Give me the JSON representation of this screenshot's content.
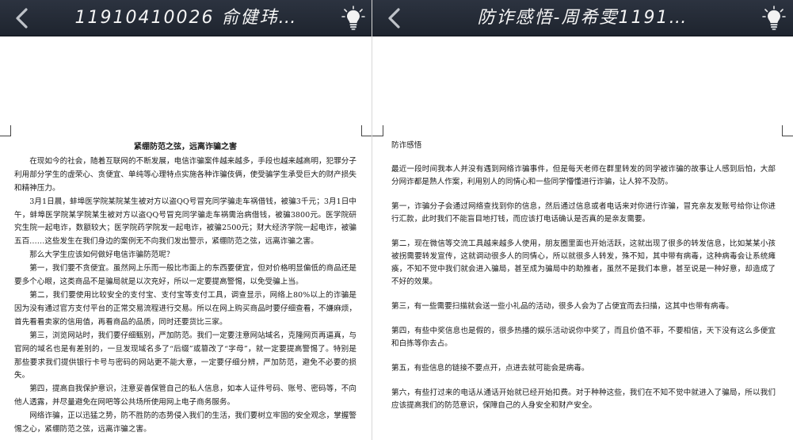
{
  "left": {
    "title": "11910410026 俞健玮…",
    "doc_title": "紧绷防范之弦，远离诈骗之害",
    "paragraphs": [
      "在现如今的社会，随着互联网的不断发展，电信诈骗案件越来越多，手段也越来越高明，犯罪分子利用部分学生的虚荣心、贪便宜、单纯等心理特点实施各种诈骗伎俩，使受骗学生承受巨大的财产损失和精神压力。",
      "3月1日晨，蚌埠医学院某院某生被对方以盗QQ号冒充同学骗走车祸借钱，被骗3千元；3月1日中午，蚌埠医学院某学院某生被对方以盗QQ号冒充同学骗走车祸需治病借钱，被骗3800元。医学院研究生院一起电诈，数额较大；医学院药学院发一起电诈，被骗2500元；财大经济学院一起电诈，被骗五百……这些发生在我们身边的案例无不向我们发出警示，紧绷防范之弦，远离诈骗之害。",
      "那么大学生应该如何做好电信诈骗防范呢？",
      "第一，我们要不贪便宜。虽然网上乐而一般比市面上的东西要便宜，但对价格明显偏低的商品还是要多个心眼，这类商品不是骗局就是以次充好，所以一定要提高警惕，以免受骗上当。",
      "第二，我们要使用比较安全的支付宝、支付宝等支付工具，调查显示，网络上80%以上的诈骗是因为没有通过官方支付平台的正常交易流程进行交易。所以在网上购买商品时要仔细查看，不嫌麻烦，首先看看卖家的信用值，再看商品的品质，同时还要货比三家。",
      "第三，浏览网站时，我们要仔细甄别，严加防范。我们一定要注意网站域名，克隆网页再逼真，与官网的域名也是有差别的，一旦发现域名多了“后缀”或篡改了“字母”，就一定要提高警惕了。特别是那些要求我们提供银行卡号与密码的网站更不能大意，一定要仔细分辨，严加防范，避免不必要的损失。",
      "第四，提高自我保护意识，注意妥善保管自己的私人信息，如本人证件号码、账号、密码等，不向他人透露，并尽量避免在网吧等公共场所使用网上电子商务服务。",
      "网络诈骗，正以迅猛之势，防不胜防的态势侵入我们的生活，我们要树立牢固的安全观念，掌握警惕之心，紧绷防范之弦，远离诈骗之害。"
    ]
  },
  "right": {
    "title": "防诈感悟-周希雯1191…",
    "heading": "防诈感悟",
    "paragraphs": [
      "最近一段时间我本人并没有遇到网络诈骗事件，但是每天老师在群里转发的同学被诈骗的故事让人感到后怕，大部分网诈都是熟人作案，利用别人的同情心和一些同学懵懂进行诈骗，让人猝不及防。",
      "第一，诈骗分子会通过网络查找到你的信息，然后通过信息或者电话来对你进行诈骗，冒充亲友发账号给你让你进行汇款，此时我们不能盲目地打钱，而应该打电话确认是否真的是亲友需要。",
      "第二，现在微信等交流工具越来越多人使用，朋友圈里面也开始活跃，这就出现了很多的转发信息，比如某某小孩被拐需要转发宣传，这就调动很多人的同情心，所以就很多人转发，殊不知，其中带有病毒，这种病毒会让系统瘫痪，不知不觉中我们就会进入骗局，甚至成为骗局中的助推者，虽然不是我们本意，甚至说是一种好意，却造成了不好的效果。",
      "第三，有一些需要扫描就会送一些小礼品的活动，很多人会为了占便宜而去扫描，这其中也带有病毒。",
      "第四，有些中奖信息也是假的，很多热播的娱乐活动说你中奖了，而且价值不菲，不要相信，天下没有这么多便宜和白拣等你去占。",
      "第五，有些信息的链接不要点开，点进去就可能会是病毒。",
      "第六，有些打过来的电话从通话开始就已经开始扣费。对于种种这些，我们在不知不觉中就进入了骗局，所以我们应该提高我们的防范意识，保障自己的人身安全和财产安全。"
    ]
  },
  "colors": {
    "topbar": "#232a35",
    "title_text": "#f5f5f5",
    "page_bg": "#ffffff",
    "text": "#1a1a1a"
  },
  "icons": {
    "back": "chevron-left-icon",
    "bulb": "light-bulb-icon"
  }
}
